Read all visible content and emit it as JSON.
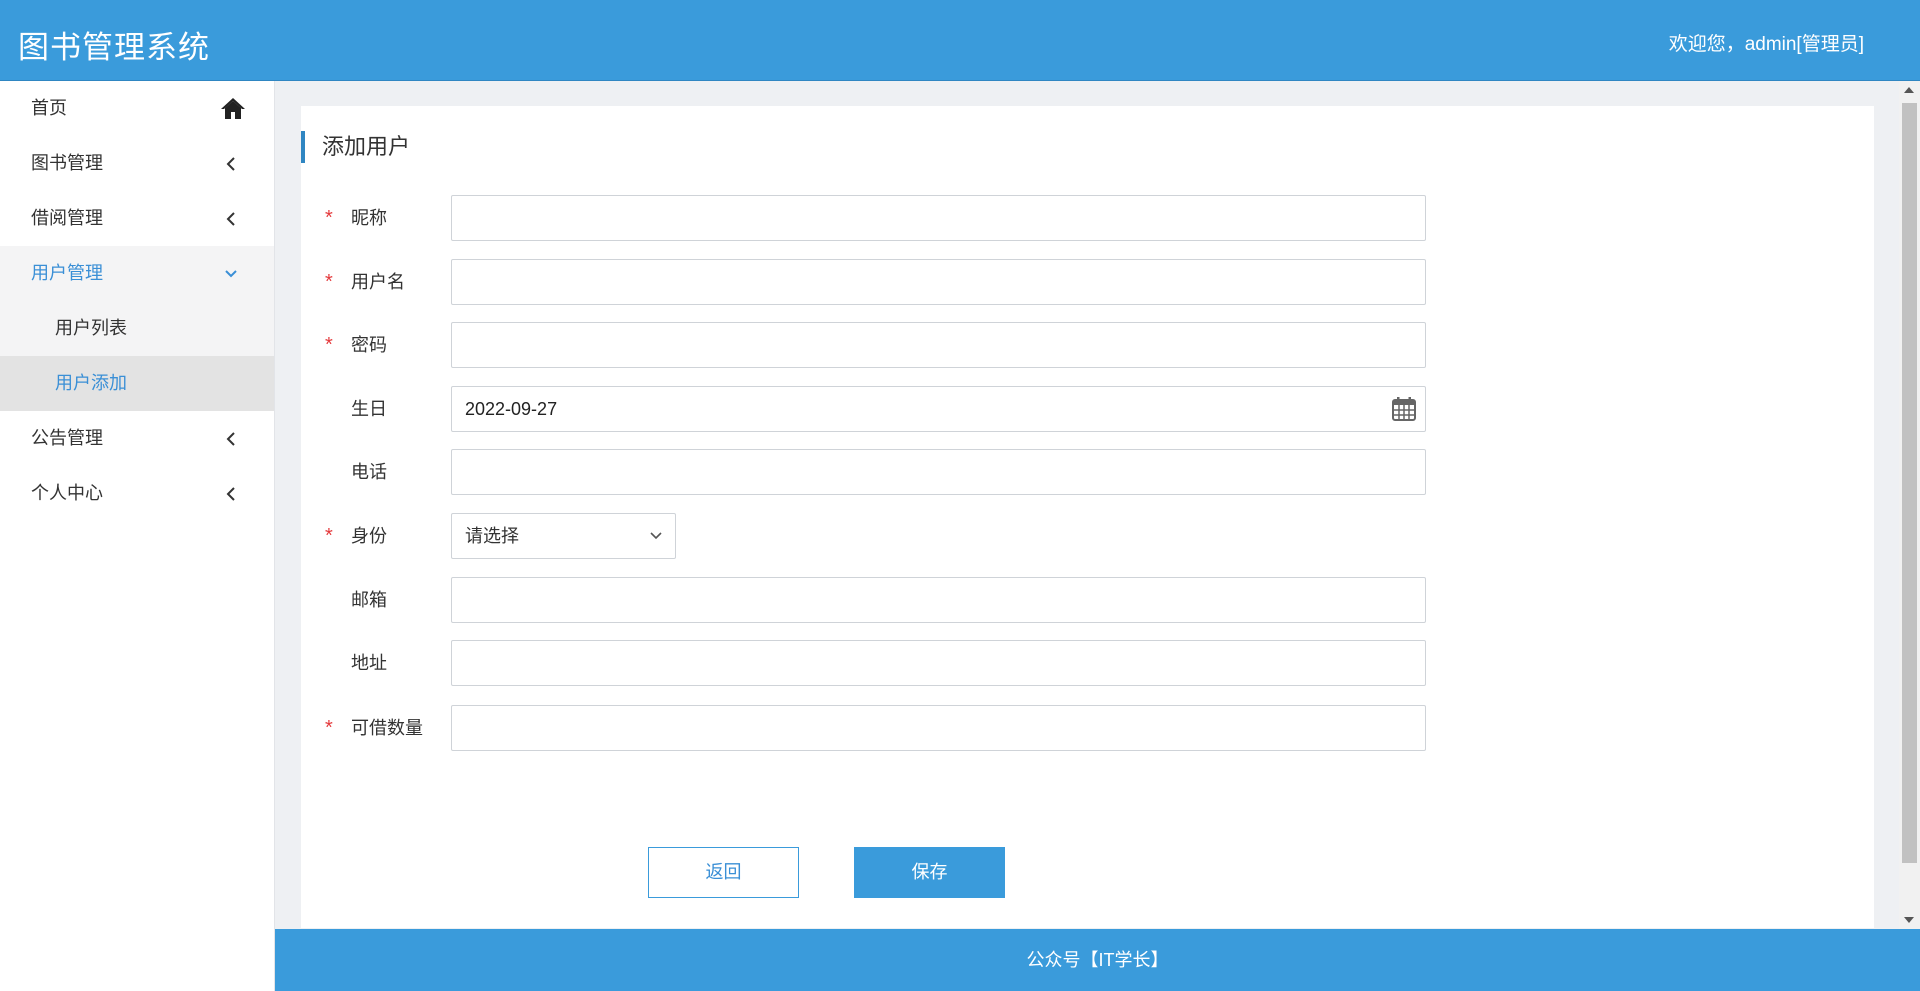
{
  "header": {
    "brand": "图书管理系统",
    "welcome": "欢迎您，admin[管理员]"
  },
  "sidebar": {
    "items": [
      {
        "label": "首页",
        "icon": "home-icon"
      },
      {
        "label": "图书管理",
        "icon": "chevron-left-icon"
      },
      {
        "label": "借阅管理",
        "icon": "chevron-left-icon"
      },
      {
        "label": "用户管理",
        "icon": "chevron-down-icon",
        "expanded": true
      },
      {
        "label": "公告管理",
        "icon": "chevron-left-icon"
      },
      {
        "label": "个人中心",
        "icon": "chevron-left-icon"
      }
    ],
    "user_sub": [
      {
        "label": "用户列表"
      },
      {
        "label": "用户添加",
        "selected": true
      }
    ]
  },
  "panel": {
    "title": "添加用户"
  },
  "form": {
    "nickname": {
      "label": "昵称",
      "required": "*",
      "value": ""
    },
    "username": {
      "label": "用户名",
      "required": "*",
      "value": ""
    },
    "password": {
      "label": "密码",
      "required": "*",
      "value": ""
    },
    "birthday": {
      "label": "生日",
      "value": "2022-09-27"
    },
    "phone": {
      "label": "电话",
      "value": ""
    },
    "role": {
      "label": "身份",
      "required": "*",
      "selected": "请选择"
    },
    "email": {
      "label": "邮箱",
      "value": ""
    },
    "address": {
      "label": "地址",
      "value": ""
    },
    "quota": {
      "label": "可借数量",
      "required": "*",
      "value": ""
    }
  },
  "buttons": {
    "back": "返回",
    "save": "保存"
  },
  "footer": {
    "text": "公众号【IT学长】"
  },
  "colors": {
    "primary": "#3a9bdb",
    "active_text": "#3a8fd6",
    "required": "#e4393c"
  }
}
